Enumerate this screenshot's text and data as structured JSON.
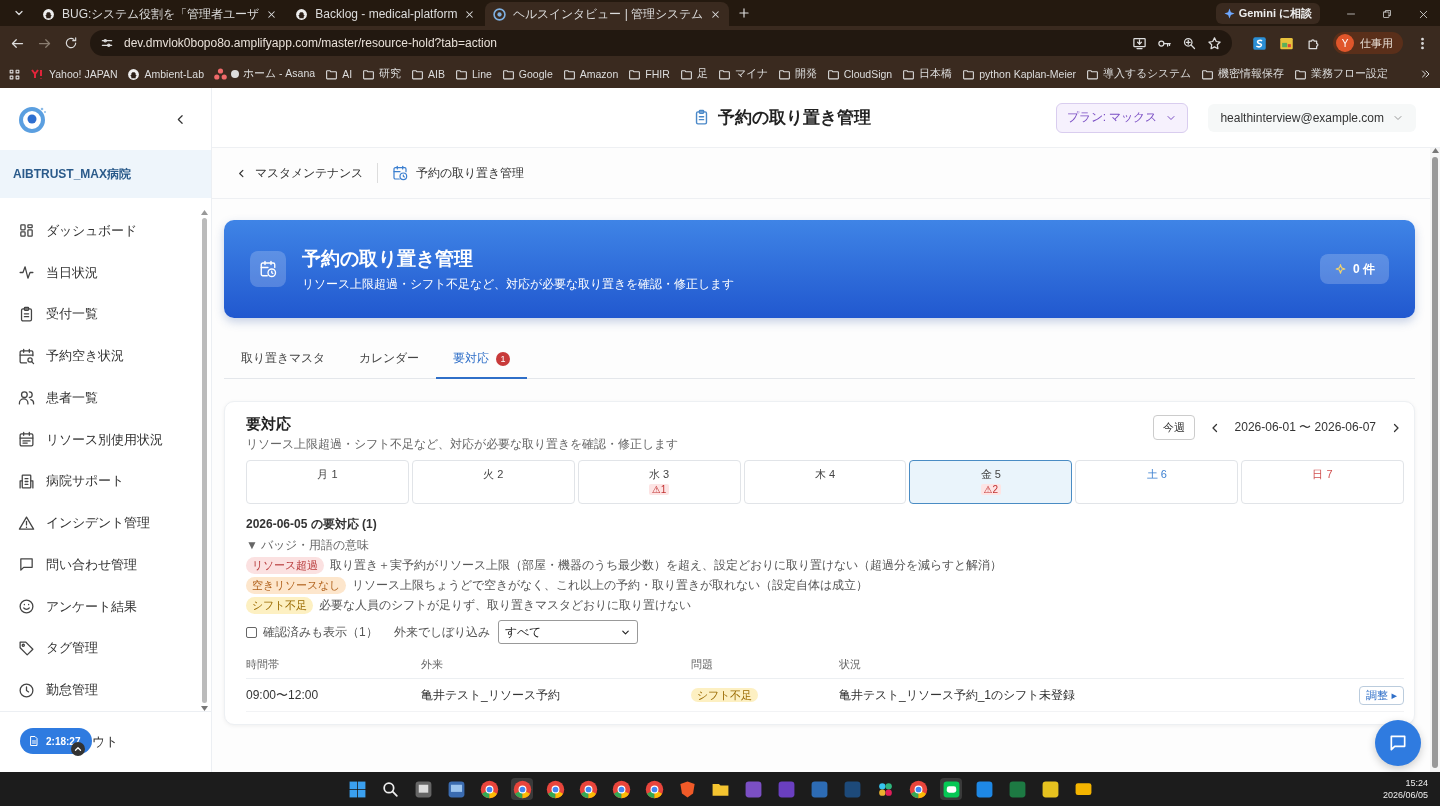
{
  "browser": {
    "tabs": [
      {
        "title": "BUG:システム役割を「管理者ユーザ",
        "kind": "github",
        "selected": false
      },
      {
        "title": "Backlog - medical-platform",
        "kind": "github",
        "selected": false
      },
      {
        "title": "ヘルスインタビュー | 管理システム",
        "kind": "app",
        "selected": true
      }
    ],
    "gemini": "Gemini に相談",
    "address": "dev.dmvlok0bopo8o.amplifyapp.com/master/resource-hold?tab=action",
    "profile": {
      "initial": "Y",
      "label": "仕事用"
    },
    "bookmarks": [
      {
        "label": "Yahoo! JAPAN",
        "kind": "yahoo"
      },
      {
        "label": "Ambient-Lab",
        "kind": "github"
      },
      {
        "label": "ホーム - Asana",
        "kind": "asana"
      },
      {
        "label": "AI",
        "kind": "folder"
      },
      {
        "label": "研究",
        "kind": "folder"
      },
      {
        "label": "AIB",
        "kind": "folder"
      },
      {
        "label": "Line",
        "kind": "folder"
      },
      {
        "label": "Google",
        "kind": "folder"
      },
      {
        "label": "Amazon",
        "kind": "folder"
      },
      {
        "label": "FHIR",
        "kind": "folder"
      },
      {
        "label": "足",
        "kind": "folder"
      },
      {
        "label": "マイナ",
        "kind": "folder"
      },
      {
        "label": "開発",
        "kind": "folder"
      },
      {
        "label": "CloudSign",
        "kind": "folder"
      },
      {
        "label": "日本橋",
        "kind": "folder"
      },
      {
        "label": "python Kaplan-Meier",
        "kind": "folder"
      },
      {
        "label": "導入するシステム",
        "kind": "folder"
      },
      {
        "label": "機密情報保存",
        "kind": "folder"
      },
      {
        "label": "業務フロー設定",
        "kind": "folder"
      }
    ]
  },
  "sidebar": {
    "hospital": "AIBTRUST_MAX病院",
    "items": [
      {
        "label": "ダッシュボード",
        "kind": "grid"
      },
      {
        "label": "当日状況",
        "kind": "pulse"
      },
      {
        "label": "受付一覧",
        "kind": "clipboard"
      },
      {
        "label": "予約空き状況",
        "kind": "calsearch"
      },
      {
        "label": "患者一覧",
        "kind": "users"
      },
      {
        "label": "リソース別使用状況",
        "kind": "calendar"
      },
      {
        "label": "病院サポート",
        "kind": "building"
      },
      {
        "label": "インシデント管理",
        "kind": "warning"
      },
      {
        "label": "問い合わせ管理",
        "kind": "chat"
      },
      {
        "label": "アンケート結果",
        "kind": "smile"
      },
      {
        "label": "タグ管理",
        "kind": "tag"
      },
      {
        "label": "勤怠管理",
        "kind": "clock"
      }
    ],
    "logout": "ウト",
    "timer": "2:18:27"
  },
  "header": {
    "title": "予約の取り置き管理",
    "plan": "プラン: マックス",
    "user": "healthinterview@example.com"
  },
  "breadcrumb": {
    "back": "マスタメンテナンス",
    "current": "予約の取り置き管理"
  },
  "banner": {
    "title": "予約の取り置き管理",
    "subtitle": "リソース上限超過・シフト不足など、対応が必要な取り置きを確認・修正します",
    "count": "0 件"
  },
  "tabs": [
    {
      "label": "取り置きマスタ",
      "selected": false
    },
    {
      "label": "カレンダー",
      "selected": false
    },
    {
      "label": "要対応",
      "selected": true,
      "badge": "1"
    }
  ],
  "panel": {
    "title": "要対応",
    "subtitle": "リソース上限超過・シフト不足など、対応が必要な取り置きを確認・修正します",
    "this_week": "今週",
    "range": "2026-06-01 〜 2026-06-07",
    "days": [
      {
        "label": "月 1",
        "kind": "weekday",
        "selected": false
      },
      {
        "label": "火 2",
        "kind": "weekday",
        "selected": false
      },
      {
        "label": "水 3",
        "kind": "weekday",
        "selected": false,
        "alert": "⚠1"
      },
      {
        "label": "木 4",
        "kind": "weekday",
        "selected": false
      },
      {
        "label": "金 5",
        "kind": "weekday",
        "selected": true,
        "alert": "⚠2"
      },
      {
        "label": "土 6",
        "kind": "saturday",
        "selected": false
      },
      {
        "label": "日 7",
        "kind": "sunday",
        "selected": false
      }
    ],
    "day_heading": "2026-06-05 の要対応 (1)",
    "legend_toggle": "▼ バッジ・用語の意味",
    "legend": [
      {
        "badge": "リソース超過",
        "kind": "over",
        "text": "取り置き＋実予約がリソース上限（部屋・機器のうち最少数）を超え、設定どおりに取り置けない（超過分を減らすと解消）"
      },
      {
        "badge": "空きリソースなし",
        "kind": "full",
        "text": "リソース上限ちょうどで空きがなく、これ以上の予約・取り置きが取れない（設定自体は成立）"
      },
      {
        "badge": "シフト不足",
        "kind": "shift",
        "text": "必要な人員のシフトが足りず、取り置きマスタどおりに取り置けない"
      }
    ],
    "show_confirmed": {
      "label": "確認済みも表示（1）",
      "checked": false
    },
    "filter_label": "外来でしぼり込み",
    "filter_value": "すべて",
    "columns": [
      "時間帯",
      "外来",
      "問題",
      "状況"
    ],
    "rows": [
      {
        "time": "09:00〜12:00",
        "clinic": "亀井テスト_リソース予約",
        "problem": {
          "label": "シフト不足",
          "kind": "shift"
        },
        "status": "亀井テスト_リソース予約_1のシフト未登録",
        "action": "調整 ▸"
      }
    ]
  },
  "taskbar": {
    "time": "15:24",
    "date": "2026/06/05"
  }
}
